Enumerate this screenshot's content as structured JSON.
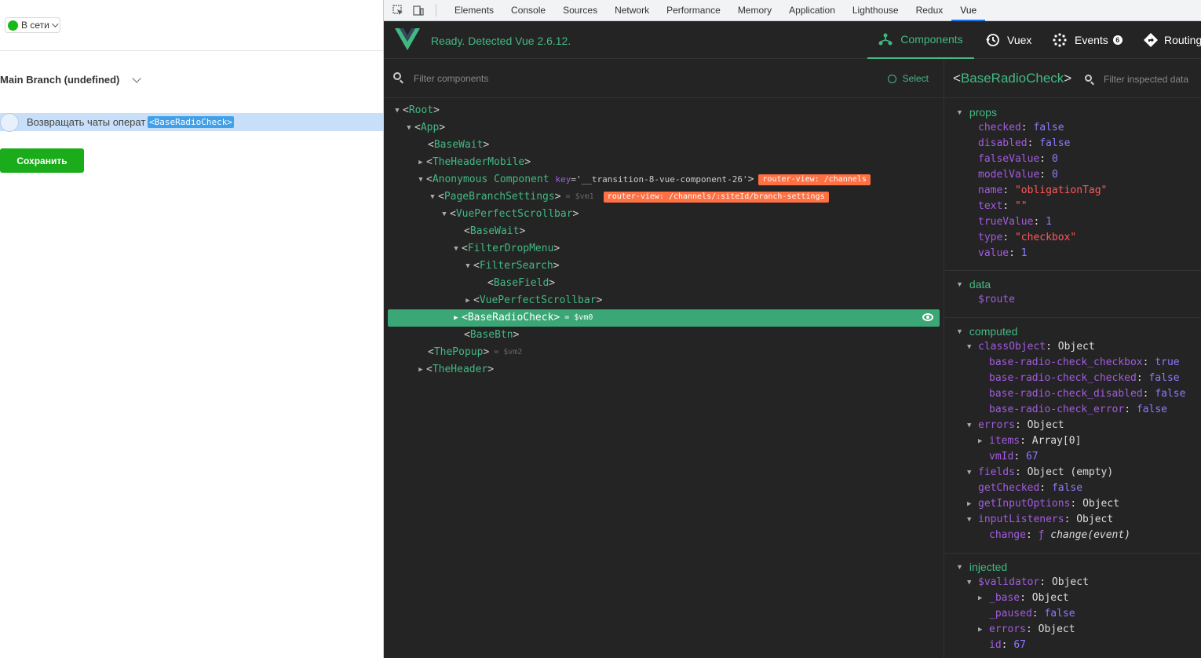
{
  "app": {
    "status_label": "В сети",
    "branch_title": "Main Branch (undefined)",
    "checkbox_label": "Возвращать чаты операт",
    "checkbox_tag": "<BaseRadioCheck>",
    "save_button": "Сохранить",
    "status_color": "#16b916",
    "button_color": "#1aac1a"
  },
  "devtools": {
    "tabs": [
      "Elements",
      "Console",
      "Sources",
      "Network",
      "Performance",
      "Memory",
      "Application",
      "Lighthouse",
      "Redux",
      "Vue"
    ],
    "active_tab": "Vue"
  },
  "vue": {
    "ready_text": "Ready. Detected Vue 2.6.12.",
    "accent_color": "#42b983",
    "nav": {
      "components": "Components",
      "vuex": "Vuex",
      "events": "Events",
      "events_badge": "6",
      "routing": "Routing"
    },
    "filter_placeholder": "Filter components",
    "select_label": "Select",
    "tree": {
      "root": "Root",
      "app": "App",
      "basewait1": "BaseWait",
      "header_mobile": "TheHeaderMobile",
      "anon": "Anonymous Component",
      "anon_key_attr": "key",
      "anon_key_val": "='__transition-8-vue-component-26'",
      "anon_route": "router-view: /channels",
      "page_branch": "PageBranchSettings",
      "page_branch_ref": "= $vm1",
      "page_branch_route": "router-view: /channels/:siteId/branch-settings",
      "scrollbar1": "VuePerfectScrollbar",
      "basewait2": "BaseWait",
      "filter_drop": "FilterDropMenu",
      "filter_search": "FilterSearch",
      "basefield": "BaseField",
      "scrollbar2": "VuePerfectScrollbar",
      "radio_check": "BaseRadioCheck",
      "radio_check_ref": "= $vm0",
      "basebtn": "BaseBtn",
      "popup": "ThePopup",
      "popup_ref": "= $vm2",
      "header": "TheHeader"
    },
    "inspector": {
      "component": "BaseRadioCheck",
      "filter_placeholder": "Filter inspected data",
      "sections": {
        "props": "props",
        "data": "data",
        "computed": "computed",
        "injected": "injected"
      },
      "props": [
        {
          "key": "checked",
          "value": "false",
          "type": "bool"
        },
        {
          "key": "disabled",
          "value": "false",
          "type": "bool"
        },
        {
          "key": "falseValue",
          "value": "0",
          "type": "num"
        },
        {
          "key": "modelValue",
          "value": "0",
          "type": "num"
        },
        {
          "key": "name",
          "value": "\"obligationTag\"",
          "type": "str"
        },
        {
          "key": "text",
          "value": "\"\"",
          "type": "str"
        },
        {
          "key": "trueValue",
          "value": "1",
          "type": "num"
        },
        {
          "key": "type",
          "value": "\"checkbox\"",
          "type": "str"
        },
        {
          "key": "value",
          "value": "1",
          "type": "num"
        }
      ],
      "data": [
        {
          "key": "$route",
          "value": "",
          "type": "obj"
        }
      ],
      "computed": [
        {
          "key": "classObject",
          "value": "Object",
          "type": "obj",
          "level": 0,
          "arrow": "down"
        },
        {
          "key": "base-radio-check_checkbox",
          "value": "true",
          "type": "bool",
          "level": 1
        },
        {
          "key": "base-radio-check_checked",
          "value": "false",
          "type": "bool",
          "level": 1
        },
        {
          "key": "base-radio-check_disabled",
          "value": "false",
          "type": "bool",
          "level": 1
        },
        {
          "key": "base-radio-check_error",
          "value": "false",
          "type": "bool",
          "level": 1
        },
        {
          "key": "errors",
          "value": "Object",
          "type": "obj",
          "level": 0,
          "arrow": "down"
        },
        {
          "key": "items",
          "value": "Array[0]",
          "type": "obj",
          "level": 1,
          "arrow": "right"
        },
        {
          "key": "vmId",
          "value": "67",
          "type": "num",
          "level": 1
        },
        {
          "key": "fields",
          "value": "Object (empty)",
          "type": "obj",
          "level": 0,
          "arrow": "down"
        },
        {
          "key": "getChecked",
          "value": "false",
          "type": "bool",
          "level": 0
        },
        {
          "key": "getInputOptions",
          "value": "Object",
          "type": "obj",
          "level": 0,
          "arrow": "right"
        },
        {
          "key": "inputListeners",
          "value": "Object",
          "type": "obj",
          "level": 0,
          "arrow": "down"
        },
        {
          "key": "change",
          "value": "change(event)",
          "type": "fn",
          "level": 1
        }
      ],
      "injected": [
        {
          "key": "$validator",
          "value": "Object",
          "type": "obj",
          "level": 0,
          "arrow": "down"
        },
        {
          "key": "_base",
          "value": "Object",
          "type": "obj",
          "level": 1,
          "arrow": "right"
        },
        {
          "key": "_paused",
          "value": "false",
          "type": "bool",
          "level": 1
        },
        {
          "key": "errors",
          "value": "Object",
          "type": "obj",
          "level": 1,
          "arrow": "right"
        },
        {
          "key": "id",
          "value": "67",
          "type": "num",
          "level": 1
        }
      ]
    }
  }
}
